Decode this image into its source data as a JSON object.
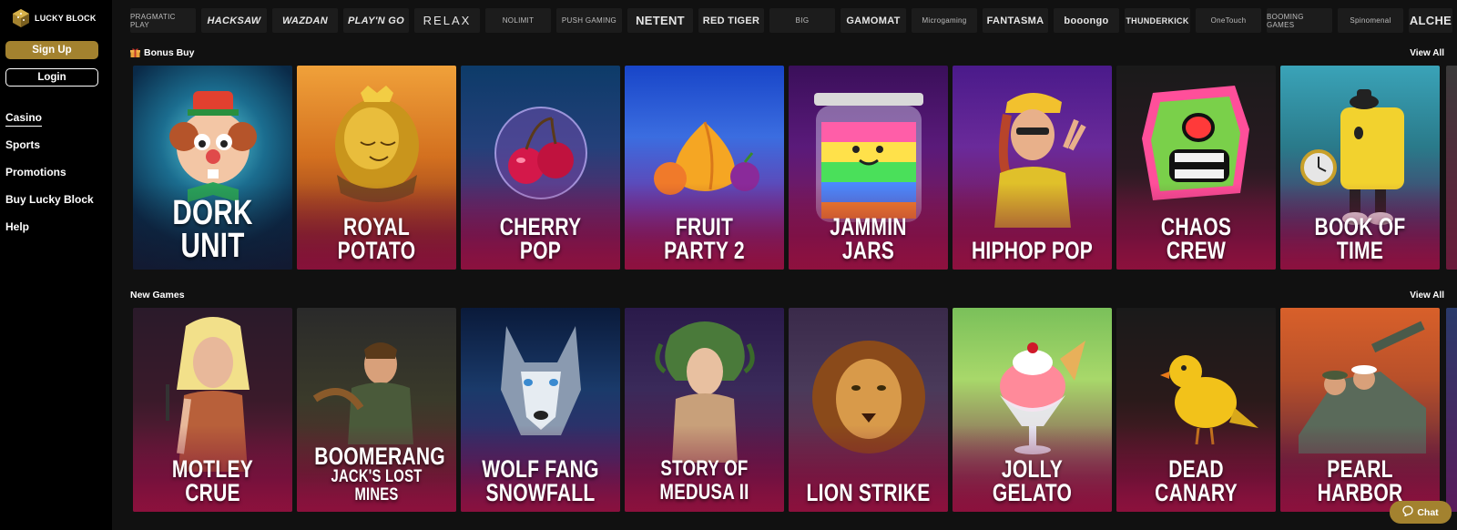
{
  "brand": {
    "name": "LUCKY BLOCK",
    "accent": "#a3822f"
  },
  "auth": {
    "signup_label": "Sign Up",
    "login_label": "Login"
  },
  "nav": [
    {
      "label": "Casino",
      "active": true
    },
    {
      "label": "Sports"
    },
    {
      "label": "Promotions"
    },
    {
      "label": "Buy Lucky Block"
    },
    {
      "label": "Help"
    }
  ],
  "providers": [
    "PRAGMATIC PLAY",
    "HACKSAW",
    "WAZDAN",
    "PLAY'N GO",
    "RELAX",
    "NOLIMIT",
    "PUSH GAMING",
    "NETENT",
    "RED TIGER",
    "BIG",
    "GAMOMAT",
    "Microgaming",
    "FANTASMA",
    "booongo",
    "THUNDERKICK",
    "OneTouch",
    "BOOMING GAMES",
    "Spinomenal",
    "ALCHE"
  ],
  "sections": {
    "bonus_buy": {
      "title": "Bonus Buy",
      "view_all": "View All",
      "games": [
        {
          "title": "DORK UNIT"
        },
        {
          "title": "ROYAL POTATO"
        },
        {
          "title": "CHERRY POP"
        },
        {
          "title": "FRUIT PARTY 2"
        },
        {
          "title": "JAMMIN JARS"
        },
        {
          "title": "HIPHOP POP"
        },
        {
          "title": "CHAOS CREW"
        },
        {
          "title": "BOOK OF TIME"
        }
      ]
    },
    "new_games": {
      "title": "New Games",
      "view_all": "View All",
      "games": [
        {
          "title": "MOTLEY CRUE"
        },
        {
          "title": "BOOMERANG",
          "subtitle": "JACK'S LOST MINES"
        },
        {
          "title": "WOLF FANG SNOWFALL"
        },
        {
          "title": "STORY OF MEDUSA II"
        },
        {
          "title": "LION STRIKE"
        },
        {
          "title": "JOLLY GELATO"
        },
        {
          "title": "DEAD CANARY"
        },
        {
          "title": "PEARL HARBOR"
        }
      ]
    }
  },
  "chat": {
    "label": "Chat"
  }
}
